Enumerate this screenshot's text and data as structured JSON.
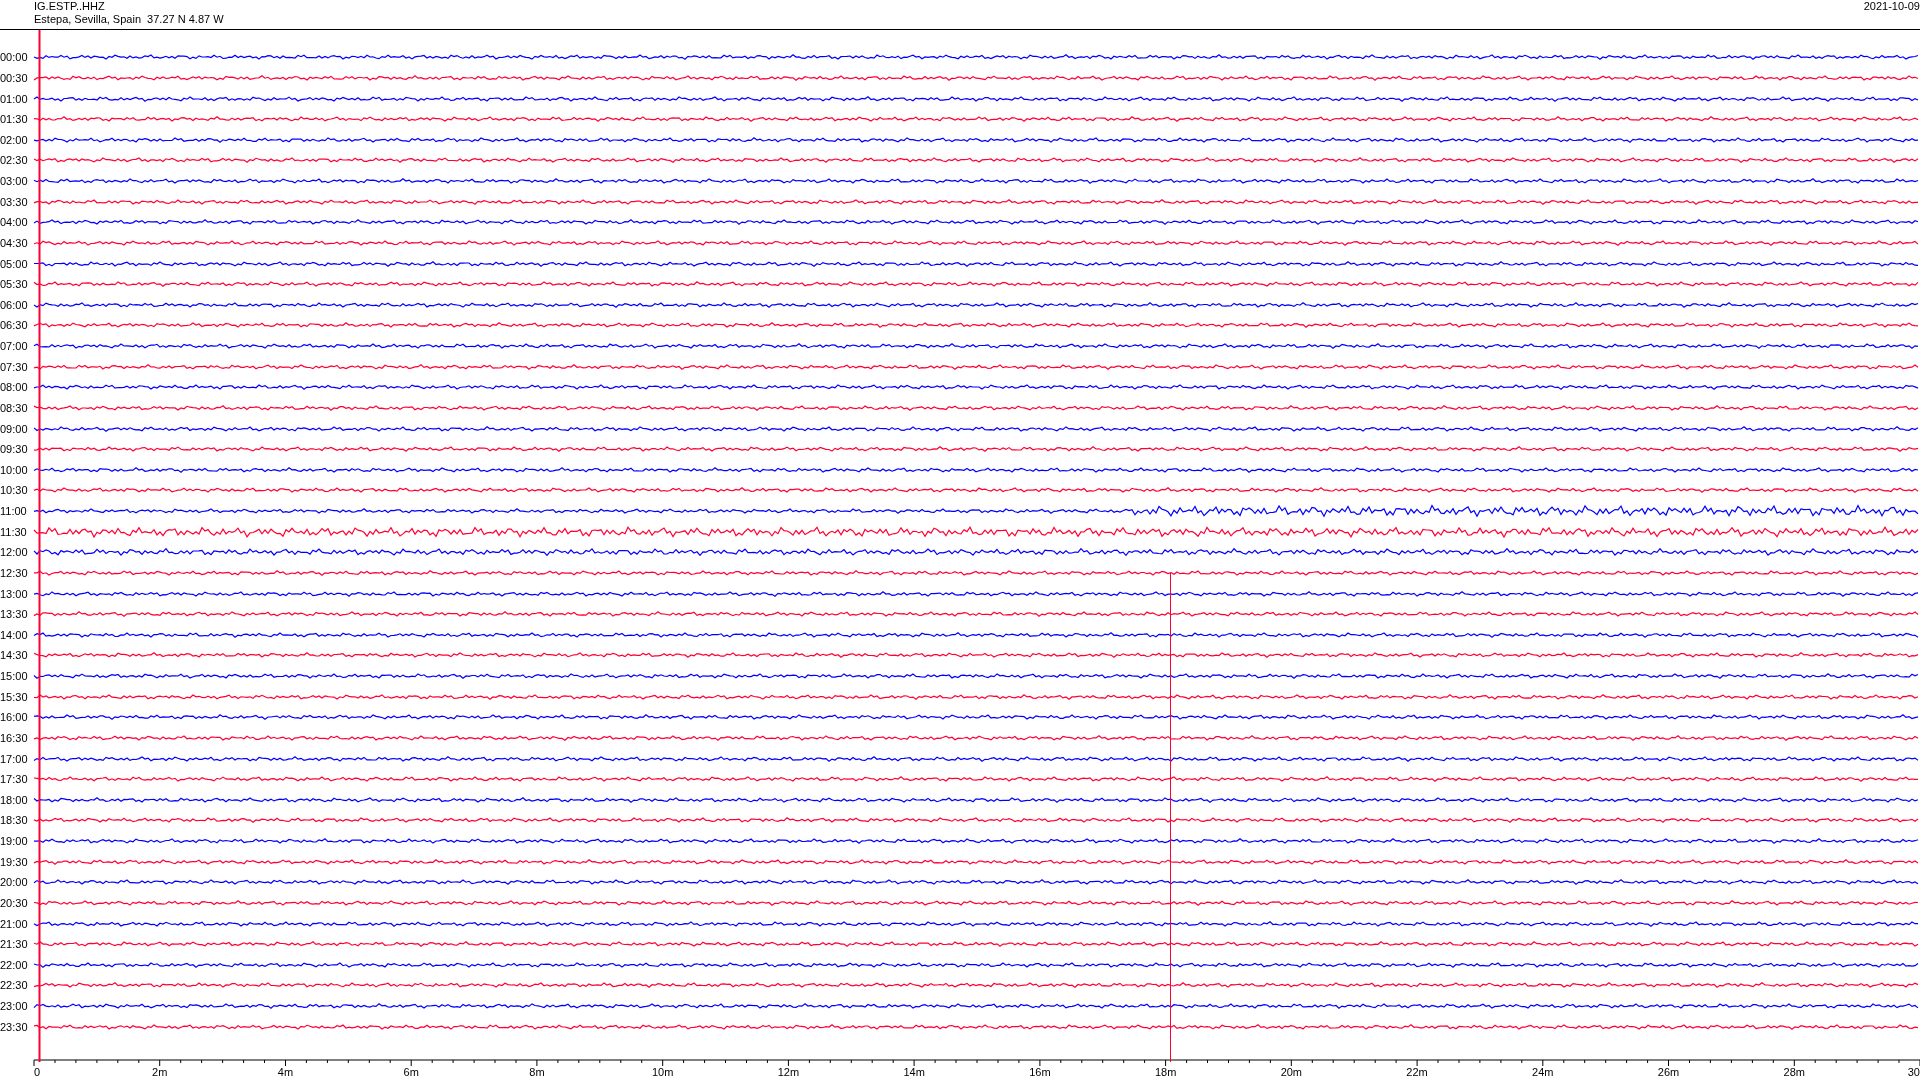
{
  "header": {
    "station": "IG.ESTP..HHZ",
    "location": "Estepa, Sevilla, Spain  37.27 N 4.87 W",
    "date": "2021-10-09"
  },
  "rows": [
    {
      "label": "00:00",
      "color": "#0000ff"
    },
    {
      "label": "00:30",
      "color": "#ff0033"
    },
    {
      "label": "01:00",
      "color": "#0000ff"
    },
    {
      "label": "01:30",
      "color": "#ff0033"
    },
    {
      "label": "02:00",
      "color": "#0000ff"
    },
    {
      "label": "02:30",
      "color": "#ff0033"
    },
    {
      "label": "03:00",
      "color": "#0000ff"
    },
    {
      "label": "03:30",
      "color": "#ff0033"
    },
    {
      "label": "04:00",
      "color": "#0000ff"
    },
    {
      "label": "04:30",
      "color": "#ff0033"
    },
    {
      "label": "05:00",
      "color": "#0000ff"
    },
    {
      "label": "05:30",
      "color": "#ff0033"
    },
    {
      "label": "06:00",
      "color": "#0000ff"
    },
    {
      "label": "06:30",
      "color": "#ff0033"
    },
    {
      "label": "07:00",
      "color": "#0000ff"
    },
    {
      "label": "07:30",
      "color": "#ff0033"
    },
    {
      "label": "08:00",
      "color": "#0000ff"
    },
    {
      "label": "08:30",
      "color": "#ff0033"
    },
    {
      "label": "09:00",
      "color": "#0000ff"
    },
    {
      "label": "09:30",
      "color": "#ff0033"
    },
    {
      "label": "10:00",
      "color": "#0000ff"
    },
    {
      "label": "10:30",
      "color": "#ff0033"
    },
    {
      "label": "11:00",
      "color": "#0000ff"
    },
    {
      "label": "11:30",
      "color": "#ff0033"
    },
    {
      "label": "12:00",
      "color": "#0000ff"
    },
    {
      "label": "12:30",
      "color": "#ff0033"
    },
    {
      "label": "13:00",
      "color": "#0000ff"
    },
    {
      "label": "13:30",
      "color": "#ff0033"
    },
    {
      "label": "14:00",
      "color": "#0000ff"
    },
    {
      "label": "14:30",
      "color": "#ff0033"
    },
    {
      "label": "15:00",
      "color": "#0000ff"
    },
    {
      "label": "15:30",
      "color": "#ff0033"
    },
    {
      "label": "16:00",
      "color": "#0000ff"
    },
    {
      "label": "16:30",
      "color": "#ff0033"
    },
    {
      "label": "17:00",
      "color": "#0000ff"
    },
    {
      "label": "17:30",
      "color": "#ff0033"
    },
    {
      "label": "18:00",
      "color": "#0000ff"
    },
    {
      "label": "18:30",
      "color": "#ff0033"
    },
    {
      "label": "19:00",
      "color": "#0000ff"
    },
    {
      "label": "19:30",
      "color": "#ff0033"
    },
    {
      "label": "20:00",
      "color": "#0000ff"
    },
    {
      "label": "20:30",
      "color": "#ff0033"
    },
    {
      "label": "21:00",
      "color": "#0000ff"
    },
    {
      "label": "21:30",
      "color": "#ff0033"
    },
    {
      "label": "22:00",
      "color": "#0000ff"
    },
    {
      "label": "22:30",
      "color": "#ff0033"
    },
    {
      "label": "23:00",
      "color": "#0000ff"
    },
    {
      "label": "23:30",
      "color": "#ff0033"
    }
  ],
  "x_axis": {
    "ticks": [
      "0",
      "2m",
      "4m",
      "6m",
      "8m",
      "10m",
      "12m",
      "14m",
      "16m",
      "18m",
      "20m",
      "22m",
      "24m",
      "26m",
      "28m",
      "30"
    ]
  }
}
